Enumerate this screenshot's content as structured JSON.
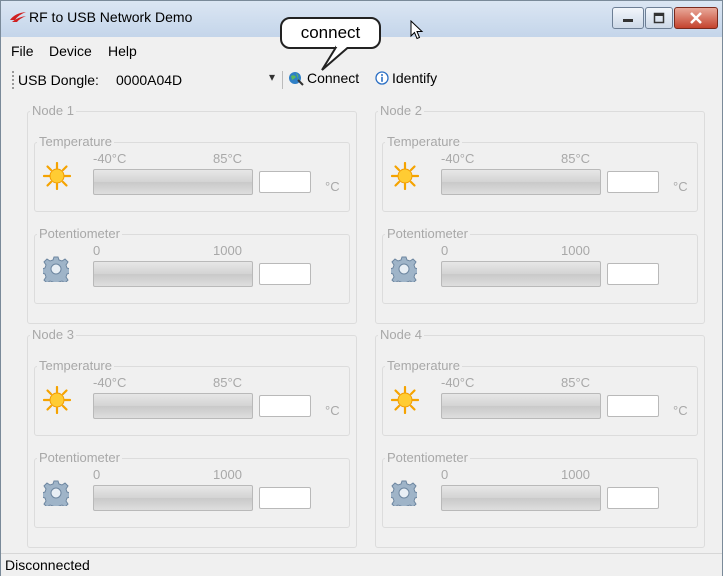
{
  "window": {
    "title": "RF to USB Network Demo"
  },
  "menu": {
    "items": [
      "File",
      "Device",
      "Help"
    ]
  },
  "toolbar": {
    "dongle_label": "USB Dongle:",
    "dongle_value": "0000A04D",
    "dropdown_arrow": "▾",
    "connect_label": "Connect",
    "identify_label": "Identify"
  },
  "callout": {
    "text": "connect"
  },
  "nodes": [
    {
      "title": "Node 1",
      "temperature": {
        "title": "Temperature",
        "min": "-40°C",
        "max": "85°C",
        "unit": "°C",
        "value": ""
      },
      "potentiometer": {
        "title": "Potentiometer",
        "min": "0",
        "max": "1000",
        "value": ""
      }
    },
    {
      "title": "Node 2",
      "temperature": {
        "title": "Temperature",
        "min": "-40°C",
        "max": "85°C",
        "unit": "°C",
        "value": ""
      },
      "potentiometer": {
        "title": "Potentiometer",
        "min": "0",
        "max": "1000",
        "value": ""
      }
    },
    {
      "title": "Node 3",
      "temperature": {
        "title": "Temperature",
        "min": "-40°C",
        "max": "85°C",
        "unit": "°C",
        "value": ""
      },
      "potentiometer": {
        "title": "Potentiometer",
        "min": "0",
        "max": "1000",
        "value": ""
      }
    },
    {
      "title": "Node 4",
      "temperature": {
        "title": "Temperature",
        "min": "-40°C",
        "max": "85°C",
        "unit": "°C",
        "value": ""
      },
      "potentiometer": {
        "title": "Potentiometer",
        "min": "0",
        "max": "1000",
        "value": ""
      }
    }
  ],
  "status": {
    "text": "Disconnected"
  },
  "icons": {
    "app": "silabs-logo-icon",
    "connect": "globe-plug-icon",
    "identify": "info-icon",
    "temperature": "sun-icon",
    "potentiometer": "gear-icon"
  },
  "colors": {
    "titlebar": "#c4d5ea",
    "close_button": "#c4432e",
    "disabled_text": "#a8a8a8",
    "background": "#f0f0f0"
  }
}
